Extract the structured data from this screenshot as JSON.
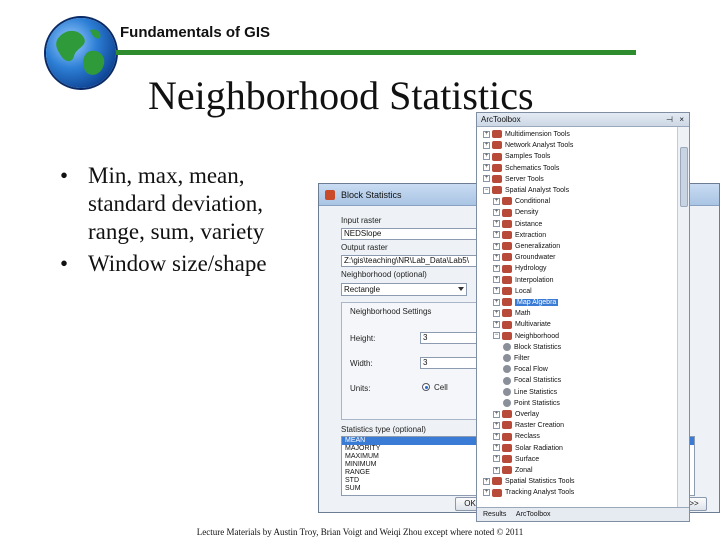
{
  "slide": {
    "course_title": "Fundamentals of GIS",
    "title": "Neighborhood Statistics",
    "bullets": [
      "Min, max, mean, standard deviation, range, sum, variety",
      "Window size/shape"
    ],
    "footer": "Lecture Materials by Austin Troy, Brian Voigt and Weiqi Zhou except where noted © 2011"
  },
  "dialog": {
    "title": "Block Statistics",
    "input_label": "Input raster",
    "input_value": "NEDSlope",
    "output_label": "Output raster",
    "output_value": "Z:\\gis\\teaching\\NR\\Lab_Data\\Lab5\\",
    "neighborhood_label": "Neighborhood (optional)",
    "neighborhood_value": "Rectangle",
    "settings_label": "Neighborhood Settings",
    "height_label": "Height:",
    "height_value": "3",
    "width_label": "Width:",
    "width_value": "3",
    "units_label": "Units:",
    "units_value": "Cell",
    "stats_label": "Statistics type (optional)",
    "stats_options": [
      "MEAN",
      "MAJORITY",
      "MAXIMUM",
      "MINIMUM",
      "RANGE",
      "STD",
      "SUM"
    ],
    "ok_label": "OK",
    "more_label": ">>"
  },
  "toolbox": {
    "title": "ArcToolbox",
    "rows": [
      {
        "label": "Multidimension Tools",
        "level": 0,
        "pm": "+",
        "kind": "box"
      },
      {
        "label": "Network Analyst Tools",
        "level": 0,
        "pm": "+",
        "kind": "box"
      },
      {
        "label": "Samples Tools",
        "level": 0,
        "pm": "+",
        "kind": "box"
      },
      {
        "label": "Schematics Tools",
        "level": 0,
        "pm": "+",
        "kind": "box"
      },
      {
        "label": "Server Tools",
        "level": 0,
        "pm": "+",
        "kind": "box"
      },
      {
        "label": "Spatial Analyst Tools",
        "level": 0,
        "pm": "−",
        "kind": "box"
      },
      {
        "label": "Conditional",
        "level": 1,
        "pm": "+",
        "kind": "box"
      },
      {
        "label": "Density",
        "level": 1,
        "pm": "+",
        "kind": "box"
      },
      {
        "label": "Distance",
        "level": 1,
        "pm": "+",
        "kind": "box"
      },
      {
        "label": "Extraction",
        "level": 1,
        "pm": "+",
        "kind": "box"
      },
      {
        "label": "Generalization",
        "level": 1,
        "pm": "+",
        "kind": "box"
      },
      {
        "label": "Groundwater",
        "level": 1,
        "pm": "+",
        "kind": "box"
      },
      {
        "label": "Hydrology",
        "level": 1,
        "pm": "+",
        "kind": "box"
      },
      {
        "label": "Interpolation",
        "level": 1,
        "pm": "+",
        "kind": "box"
      },
      {
        "label": "Local",
        "level": 1,
        "pm": "+",
        "kind": "box"
      },
      {
        "label": "Map Algebra",
        "level": 1,
        "pm": "+",
        "kind": "box",
        "highlight": true
      },
      {
        "label": "Math",
        "level": 1,
        "pm": "+",
        "kind": "box"
      },
      {
        "label": "Multivariate",
        "level": 1,
        "pm": "+",
        "kind": "box"
      },
      {
        "label": "Neighborhood",
        "level": 1,
        "pm": "−",
        "kind": "box"
      },
      {
        "label": "Block Statistics",
        "level": 2,
        "pm": "",
        "kind": "tool"
      },
      {
        "label": "Filter",
        "level": 2,
        "pm": "",
        "kind": "tool"
      },
      {
        "label": "Focal Flow",
        "level": 2,
        "pm": "",
        "kind": "tool"
      },
      {
        "label": "Focal Statistics",
        "level": 2,
        "pm": "",
        "kind": "tool"
      },
      {
        "label": "Line Statistics",
        "level": 2,
        "pm": "",
        "kind": "tool"
      },
      {
        "label": "Point Statistics",
        "level": 2,
        "pm": "",
        "kind": "tool"
      },
      {
        "label": "Overlay",
        "level": 1,
        "pm": "+",
        "kind": "box"
      },
      {
        "label": "Raster Creation",
        "level": 1,
        "pm": "+",
        "kind": "box"
      },
      {
        "label": "Reclass",
        "level": 1,
        "pm": "+",
        "kind": "box"
      },
      {
        "label": "Solar Radiation",
        "level": 1,
        "pm": "+",
        "kind": "box"
      },
      {
        "label": "Surface",
        "level": 1,
        "pm": "+",
        "kind": "box"
      },
      {
        "label": "Zonal",
        "level": 1,
        "pm": "+",
        "kind": "box"
      },
      {
        "label": "Spatial Statistics Tools",
        "level": 0,
        "pm": "+",
        "kind": "box"
      },
      {
        "label": "Tracking Analyst Tools",
        "level": 0,
        "pm": "+",
        "kind": "box"
      }
    ],
    "footer_tabs": [
      "Results",
      "ArcToolbox"
    ]
  }
}
